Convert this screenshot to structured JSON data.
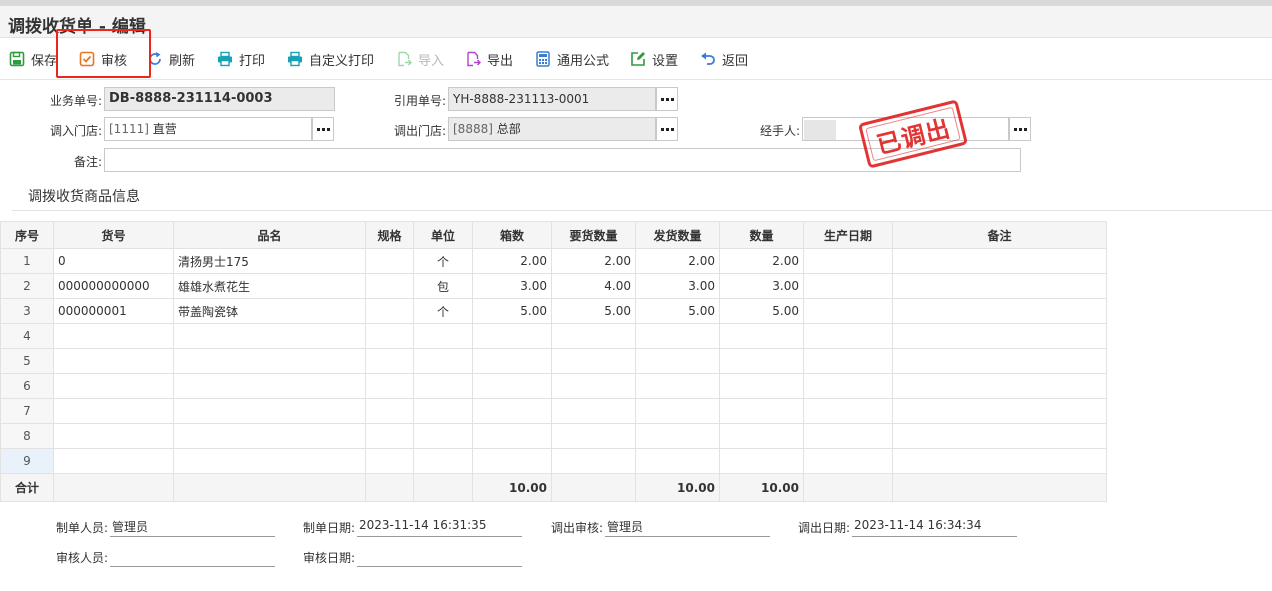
{
  "window": {
    "title": "调拨收货单 - 编辑"
  },
  "toolbar": {
    "save": "保存",
    "audit": "审核",
    "refresh": "刷新",
    "print": "打印",
    "custom_print": "自定义打印",
    "import": "导入",
    "export": "导出",
    "formula": "通用公式",
    "settings": "设置",
    "back": "返回"
  },
  "form": {
    "doc_no_label": "业务单号:",
    "doc_no": "DB-8888-231114-0003",
    "ref_no_label": "引用单号:",
    "ref_no": "YH-8888-231113-0001",
    "in_store_label": "调入门店:",
    "in_store_code": "[1111]",
    "in_store_name": "直营",
    "out_store_label": "调出门店:",
    "out_store_code": "[8888]",
    "out_store_name": "总部",
    "handler_label": "经手人:",
    "handler": "",
    "remark_label": "备注:",
    "remark": ""
  },
  "stamp": {
    "text": "已调出"
  },
  "section": {
    "title": "调拨收货商品信息"
  },
  "table": {
    "headers": [
      "序号",
      "货号",
      "品名",
      "规格",
      "单位",
      "箱数",
      "要货数量",
      "发货数量",
      "数量",
      "生产日期",
      "备注"
    ],
    "rows": [
      {
        "idx": "1",
        "code": "0",
        "name": "清扬男士175",
        "spec": "",
        "unit": "个",
        "boxes": "2.00",
        "req_qty": "2.00",
        "ship_qty": "2.00",
        "qty": "2.00",
        "prod_date": "",
        "remark": ""
      },
      {
        "idx": "2",
        "code": "000000000000",
        "name": "雄雄水煮花生",
        "spec": "",
        "unit": "包",
        "boxes": "3.00",
        "req_qty": "4.00",
        "ship_qty": "3.00",
        "qty": "3.00",
        "prod_date": "",
        "remark": ""
      },
      {
        "idx": "3",
        "code": "000000001",
        "name": "带盖陶瓷钵",
        "spec": "",
        "unit": "个",
        "boxes": "5.00",
        "req_qty": "5.00",
        "ship_qty": "5.00",
        "qty": "5.00",
        "prod_date": "",
        "remark": ""
      }
    ],
    "empty_rows": [
      "4",
      "5",
      "6",
      "7",
      "8",
      "9"
    ],
    "total": {
      "label": "合计",
      "boxes": "10.00",
      "ship_qty": "10.00",
      "qty": "10.00"
    }
  },
  "footer": {
    "maker_label": "制单人员:",
    "maker": "管理员",
    "make_date_label": "制单日期:",
    "make_date": "2023-11-14 16:31:35",
    "out_auditor_label": "调出审核:",
    "out_auditor": "管理员",
    "out_date_label": "调出日期:",
    "out_date": "2023-11-14 16:34:34",
    "auditor_label": "审核人员:",
    "auditor": "",
    "audit_date_label": "审核日期:",
    "audit_date": ""
  },
  "colors": {
    "highlight": "#e8281e",
    "stamp": "#e02323",
    "save_icon": "#2e9b3e",
    "audit_icon": "#e8761e",
    "print_icon": "#17a2b8",
    "back_icon": "#3a7bd5"
  }
}
